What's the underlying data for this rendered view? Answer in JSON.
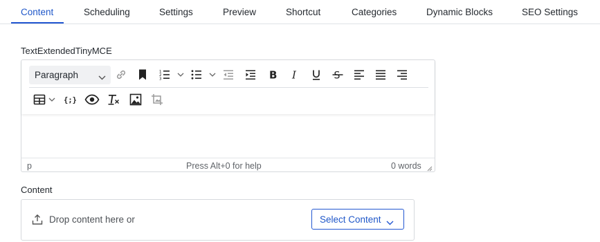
{
  "tabs": [
    {
      "label": "Content",
      "active": true
    },
    {
      "label": "Scheduling"
    },
    {
      "label": "Settings"
    },
    {
      "label": "Preview"
    },
    {
      "label": "Shortcut"
    },
    {
      "label": "Categories"
    },
    {
      "label": "Dynamic Blocks"
    },
    {
      "label": "SEO Settings"
    }
  ],
  "editor_field": {
    "label": "TextExtendedTinyMCE",
    "block_format": "Paragraph",
    "toolbar_row1": [
      "link-icon",
      "bookmark-icon",
      "numbered-list-icon",
      "bullet-list-icon",
      "outdent-icon",
      "indent-icon",
      "bold-icon",
      "italic-icon",
      "underline-icon",
      "strikethrough-icon",
      "align-left-icon",
      "align-justify-icon",
      "align-right-icon"
    ],
    "toolbar_row2": [
      "table-icon",
      "code-sample-icon",
      "preview-icon",
      "clear-formatting-icon",
      "image-icon",
      "crop-icon"
    ],
    "status_path": "p",
    "status_help": "Press Alt+0 for help",
    "status_words": "0 words"
  },
  "content_field": {
    "label": "Content",
    "drop_text": "Drop content here or",
    "select_button": "Select Content"
  },
  "colors": {
    "accent": "#2156d1",
    "text": "#24292f",
    "border": "#d6d9dd"
  }
}
